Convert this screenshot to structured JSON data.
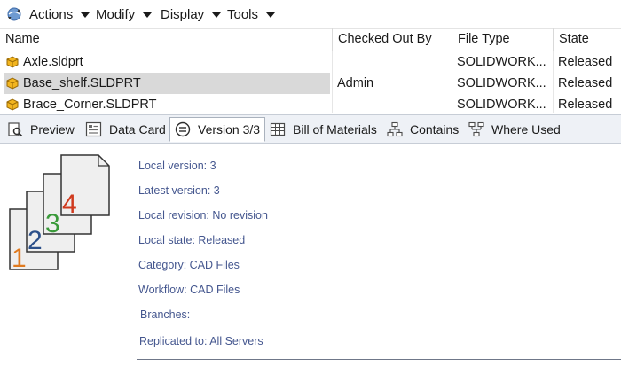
{
  "toolbar": {
    "menus": [
      "Actions",
      "Modify",
      "Display",
      "Tools"
    ]
  },
  "file_list": {
    "columns": [
      "Name",
      "Checked Out By",
      "File Type",
      "State"
    ],
    "rows": [
      {
        "name": "Axle.sldprt",
        "checked_out_by": "",
        "file_type": "SOLIDWORK...",
        "state": "Released",
        "selected": false
      },
      {
        "name": "Base_shelf.SLDPRT",
        "checked_out_by": "Admin",
        "file_type": "SOLIDWORK...",
        "state": "Released",
        "selected": true
      },
      {
        "name": "Brace_Corner.SLDPRT",
        "checked_out_by": "",
        "file_type": "SOLIDWORK...",
        "state": "Released",
        "selected": false
      }
    ]
  },
  "tabs": [
    {
      "label": "Preview",
      "icon": "preview-icon",
      "active": false
    },
    {
      "label": "Data Card",
      "icon": "data-card-icon",
      "active": false
    },
    {
      "label": "Version 3/3",
      "icon": "version-icon",
      "active": true
    },
    {
      "label": "Bill of Materials",
      "icon": "bill-of-materials-icon",
      "active": false
    },
    {
      "label": "Contains",
      "icon": "contains-icon",
      "active": false
    },
    {
      "label": "Where Used",
      "icon": "where-used-icon",
      "active": false
    }
  ],
  "version_info": {
    "local_version": "Local version: 3",
    "latest_version": "Latest version: 3",
    "local_revision": "Local revision: No revision",
    "local_state": "Local state: Released",
    "category": "Category: CAD Files",
    "workflow": "Workflow: CAD Files",
    "branches": "Branches:",
    "replicated_to": "Replicated to: All Servers"
  },
  "graphic": {
    "numbers": [
      "1",
      "2",
      "3",
      "4"
    ],
    "colors": [
      "#e07a1f",
      "#2b4f8a",
      "#3a9a3a",
      "#d03a1e"
    ]
  },
  "colors": {
    "accent_text": "#45578f",
    "tab_bar_bg": "#eef1f6",
    "selection": "#d9d9d9"
  }
}
